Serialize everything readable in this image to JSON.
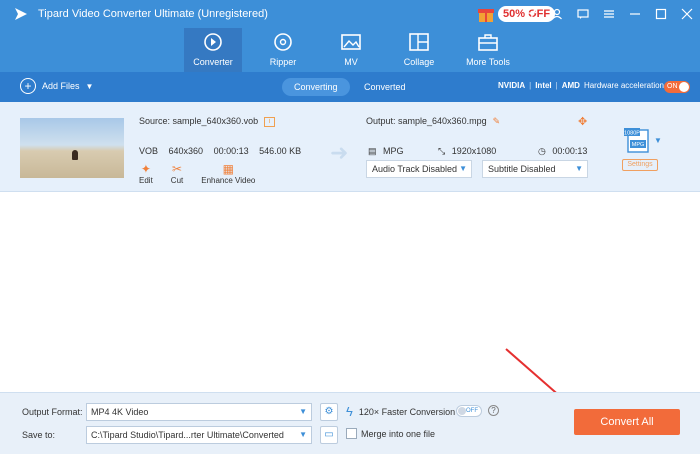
{
  "window": {
    "title": "Tipard Video Converter Ultimate (Unregistered)",
    "promo": "50% OFF"
  },
  "nav": {
    "items": [
      {
        "label": "Converter",
        "icon": "converter-icon",
        "active": true
      },
      {
        "label": "Ripper",
        "icon": "disc-icon"
      },
      {
        "label": "MV",
        "icon": "image-icon"
      },
      {
        "label": "Collage",
        "icon": "collage-icon"
      },
      {
        "label": "More Tools",
        "icon": "toolbox-icon"
      }
    ]
  },
  "toolbar": {
    "add_files": "Add Files",
    "tabs": [
      "Converting",
      "Converted"
    ],
    "hw": {
      "nvidia": "NVIDIA",
      "intel": "Intel",
      "amd": "AMD",
      "label": "Hardware acceleration",
      "state": "ON"
    }
  },
  "file": {
    "source": "Source: sample_640x360.vob",
    "format": "VOB",
    "resolution": "640x360",
    "duration": "00:00:13",
    "size": "546.00 KB",
    "tools": [
      "Edit",
      "Cut",
      "Enhance Video"
    ],
    "output": "Output: sample_640x360.mpg",
    "out_format": "MPG",
    "out_resolution": "1920x1080",
    "out_duration": "00:00:13",
    "audio": "Audio Track Disabled",
    "subtitle": "Subtitle Disabled",
    "settings": "Settings",
    "badge_top": "1080P",
    "badge_fmt": "MPG"
  },
  "bottom": {
    "output_format_label": "Output Format:",
    "output_format": "MP4 4K Video",
    "save_to_label": "Save to:",
    "save_to": "C:\\Tipard Studio\\Tipard...rter Ultimate\\Converted",
    "faster": "120× Faster Conversion",
    "faster_state": "OFF",
    "merge": "Merge into one file",
    "convert_all": "Convert All"
  },
  "colors": {
    "accent": "#3d8fd8",
    "action": "#f26b3a"
  }
}
